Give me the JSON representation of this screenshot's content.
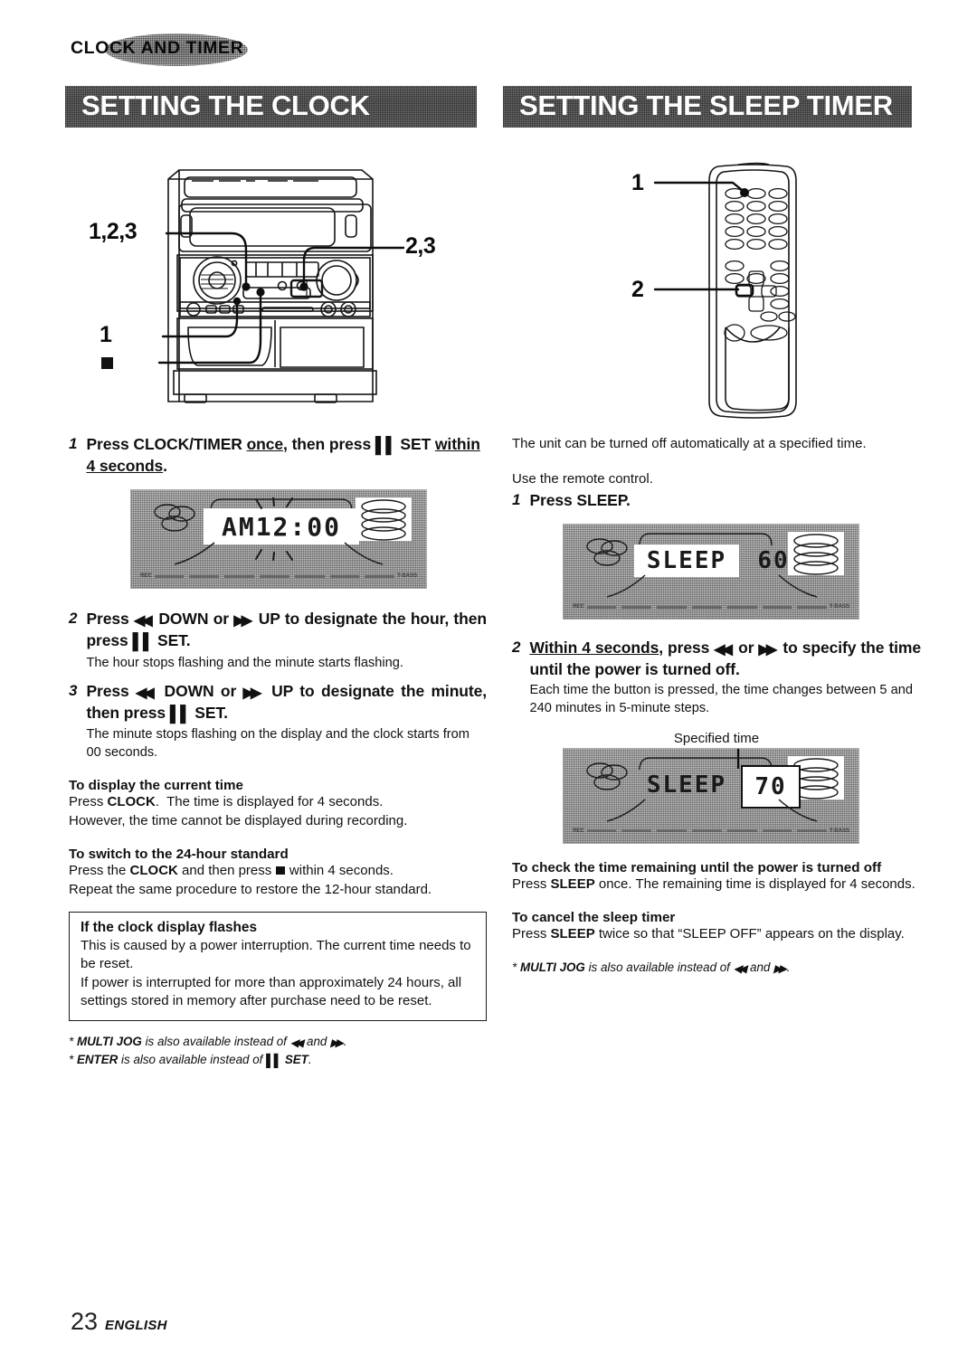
{
  "chapter": {
    "label": "CLOCK AND TIMER"
  },
  "sections": {
    "left": {
      "banner": "SETTING THE CLOCK",
      "illustration": {
        "name": "stereo-system-front-panel",
        "callouts": [
          {
            "label": "1,2,3",
            "target": "clock-timer-button"
          },
          {
            "label": "2,3",
            "target": "up-down-buttons"
          },
          {
            "label": "1",
            "target": "set-pause-button"
          },
          {
            "label": "■",
            "target": "stop-button"
          }
        ]
      },
      "steps": [
        {
          "num": "1",
          "head_parts": [
            {
              "t": "Press CLOCK/TIMER ",
              "style": "bold"
            },
            {
              "t": "once",
              "style": "bold-underline"
            },
            {
              "t": ", then press ",
              "style": "bold"
            },
            {
              "t": "▐▐",
              "style": "icon-pause"
            },
            {
              "t": " SET ",
              "style": "bold"
            },
            {
              "t": "within 4 seconds",
              "style": "bold-underline"
            },
            {
              "t": ".",
              "style": "bold"
            }
          ],
          "head_plain": "Press CLOCK/TIMER once, then press II SET within 4 seconds.",
          "note": ""
        },
        {
          "num": "2",
          "head_plain": "Press ◀◀ DOWN or ▶▶ UP to designate the hour, then press II SET.",
          "note": "The hour stops flashing and the minute starts flashing."
        },
        {
          "num": "3",
          "head_plain": "Press ◀◀ DOWN or ▶▶ UP to designate the minute, then press II SET.",
          "note": "The minute stops flashing on the display and the clock starts from 00 seconds."
        }
      ],
      "lcd": {
        "segment_text": "AM12:00",
        "mini_label_left": "REC",
        "mini_label_right": "T-BASS",
        "flashing": "hour digits flashing"
      },
      "subsections": [
        {
          "title": "To display the current time",
          "lines": [
            "Press CLOCK.  The time is displayed for 4 seconds.",
            "However, the time cannot be displayed during recording."
          ],
          "bold_terms": [
            "CLOCK"
          ]
        },
        {
          "title": "To switch to the 24-hour standard",
          "lines": [
            "Press the CLOCK and then press ■ within 4 seconds.",
            "Repeat the same procedure to restore the 12-hour standard."
          ],
          "bold_terms": [
            "CLOCK"
          ]
        }
      ],
      "note_box": {
        "title": "If the clock display flashes",
        "body": "This is caused by a power interruption. The current time needs to be reset.\nIf power is interrupted for more than approximately 24 hours, all settings stored in memory after purchase need to be reset.",
        "body_line1": "This is caused by a power interruption. The current time needs to be reset.",
        "body_line2": "If power is interrupted for more than approximately 24 hours, all settings stored in memory after purchase need to be reset."
      },
      "footnotes": [
        "* MULTI JOG is also available instead of ◀◀ and ▶▶.",
        "* ENTER is also available instead of II SET."
      ]
    },
    "right": {
      "banner": "SETTING THE SLEEP TIMER",
      "illustration": {
        "name": "remote-control",
        "callouts": [
          {
            "label": "1",
            "target": "sleep-button"
          },
          {
            "label": "2",
            "target": "rew-ff-buttons"
          }
        ]
      },
      "intro_lines": [
        "The unit can be turned off automatically at a specified time.",
        "Use the remote control."
      ],
      "steps": [
        {
          "num": "1",
          "head_plain": "Press SLEEP.",
          "note": ""
        },
        {
          "num": "2",
          "head_plain": "Within 4 seconds, press ◀◀ or ▶▶ to specify the time until the power is turned off.",
          "note": "Each time the button is pressed, the time changes between 5 and 240 minutes in 5-minute steps."
        }
      ],
      "lcd_first": {
        "segment_text": "SLEEP",
        "segment_value": "60",
        "mini_label_left": "REC",
        "mini_label_right": "T-BASS"
      },
      "lcd_second": {
        "segment_text": "SLEEP",
        "segment_value": "70",
        "mini_label_left": "REC",
        "mini_label_right": "T-BASS",
        "callout_label": "Specified time"
      },
      "subsections": [
        {
          "title": "To check the time remaining until the power is turned off",
          "lines": [
            "Press SLEEP once. The remaining time is displayed for 4 seconds."
          ],
          "bold_terms": [
            "SLEEP"
          ]
        },
        {
          "title": "To cancel the sleep timer",
          "lines": [
            "Press SLEEP twice so that “SLEEP OFF” appears on the display."
          ],
          "bold_terms": [
            "SLEEP"
          ]
        }
      ],
      "footnotes": [
        "* MULTI JOG is also available instead of ◀◀ and ▶▶."
      ]
    }
  },
  "footer": {
    "page_number": "23",
    "language": "ENGLISH"
  },
  "colors": {
    "ink": "#111111",
    "banner_fill": "#6e6e6e",
    "banner_text": "#ffffff",
    "paper": "#ffffff"
  }
}
